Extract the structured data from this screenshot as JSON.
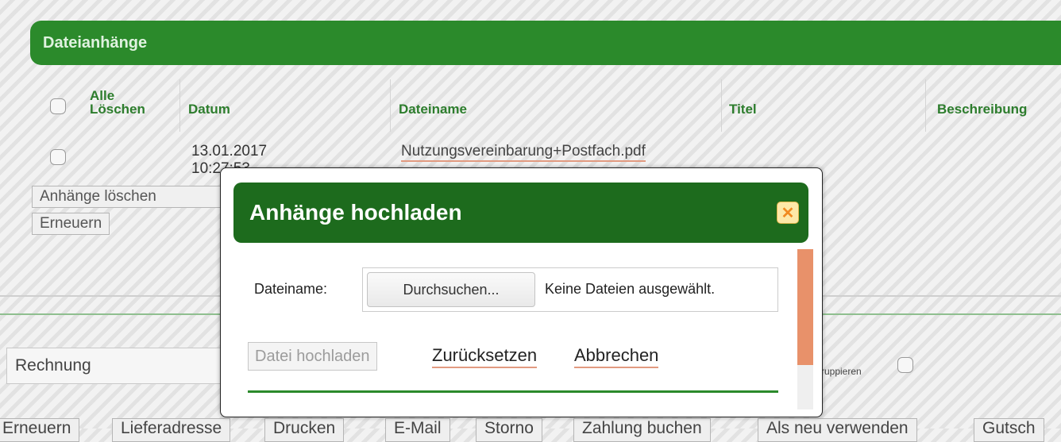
{
  "attachments": {
    "title": "Dateianhänge",
    "columns": {
      "select_all": "Alle\nLöschen",
      "date": "Datum",
      "filename": "Dateiname",
      "title": "Titel",
      "description": "Beschreibung"
    },
    "rows": [
      {
        "date": "13.01.2017 10:27:53",
        "filename": "Nutzungsvereinbarung+Postfach.pdf"
      }
    ],
    "delete_button": "Anhänge löschen",
    "renew_button": "Erneuern"
  },
  "document": {
    "type_value": "Rechnung",
    "group_label": "ruppieren"
  },
  "toolbar": {
    "buttons": [
      "Erneuern",
      "Lieferadresse",
      "Drucken",
      "E-Mail",
      "Storno",
      "Zahlung buchen",
      "Als neu verwenden",
      "Gutsch"
    ]
  },
  "modal": {
    "title": "Anhänge hochladen",
    "close_icon": "close-icon",
    "file_label": "Dateiname:",
    "browse_button": "Durchsuchen...",
    "no_file_text": "Keine Dateien ausgewählt.",
    "upload_button": "Datei hochladen",
    "reset_link": "Zurücksetzen",
    "cancel_link": "Abbrechen"
  },
  "colors": {
    "header_green": "#2b8a2b",
    "modal_header_green": "#1d6b1d",
    "accent_orange": "#e8916a"
  }
}
